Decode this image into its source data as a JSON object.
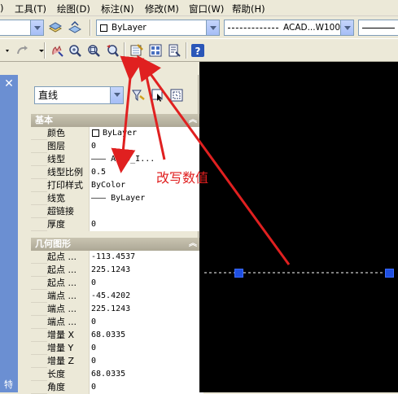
{
  "menu": {
    "tools": "工具(T)",
    "draw": "绘图(D)",
    "dimension": "标注(N)",
    "modify": "修改(M)",
    "window": "窗口(W)",
    "help": "帮助(H)"
  },
  "toolbar": {
    "layer_color": "ByLayer",
    "linetype": "ACAD...W100"
  },
  "panel": {
    "object_type": "直线",
    "section_basic": "基本",
    "section_geometry": "几何图形",
    "basic_rows": [
      {
        "label": "颜色",
        "value": "ByLayer"
      },
      {
        "label": "图层",
        "value": "0"
      },
      {
        "label": "线型",
        "value": "——— ACAD_I..."
      },
      {
        "label": "线型比例",
        "value": "0.5"
      },
      {
        "label": "打印样式",
        "value": "ByColor"
      },
      {
        "label": "线宽",
        "value": "——— ByLayer"
      },
      {
        "label": "超链接",
        "value": ""
      },
      {
        "label": "厚度",
        "value": "0"
      }
    ],
    "geometry_rows": [
      {
        "label": "起点 ...",
        "value": "-113.4537"
      },
      {
        "label": "起点 ...",
        "value": "225.1243"
      },
      {
        "label": "起点 ...",
        "value": "0"
      },
      {
        "label": "端点 ...",
        "value": "-45.4202"
      },
      {
        "label": "端点 ...",
        "value": "225.1243"
      },
      {
        "label": "端点 ...",
        "value": "0"
      },
      {
        "label": "增量 X",
        "value": "68.0335"
      },
      {
        "label": "增量 Y",
        "value": "0"
      },
      {
        "label": "增量 Z",
        "value": "0"
      },
      {
        "label": "长度",
        "value": "68.0335"
      },
      {
        "label": "角度",
        "value": "0"
      }
    ]
  },
  "annotation": {
    "text": "改写数值",
    "color": "#e02020"
  },
  "left_strip_text": "特"
}
